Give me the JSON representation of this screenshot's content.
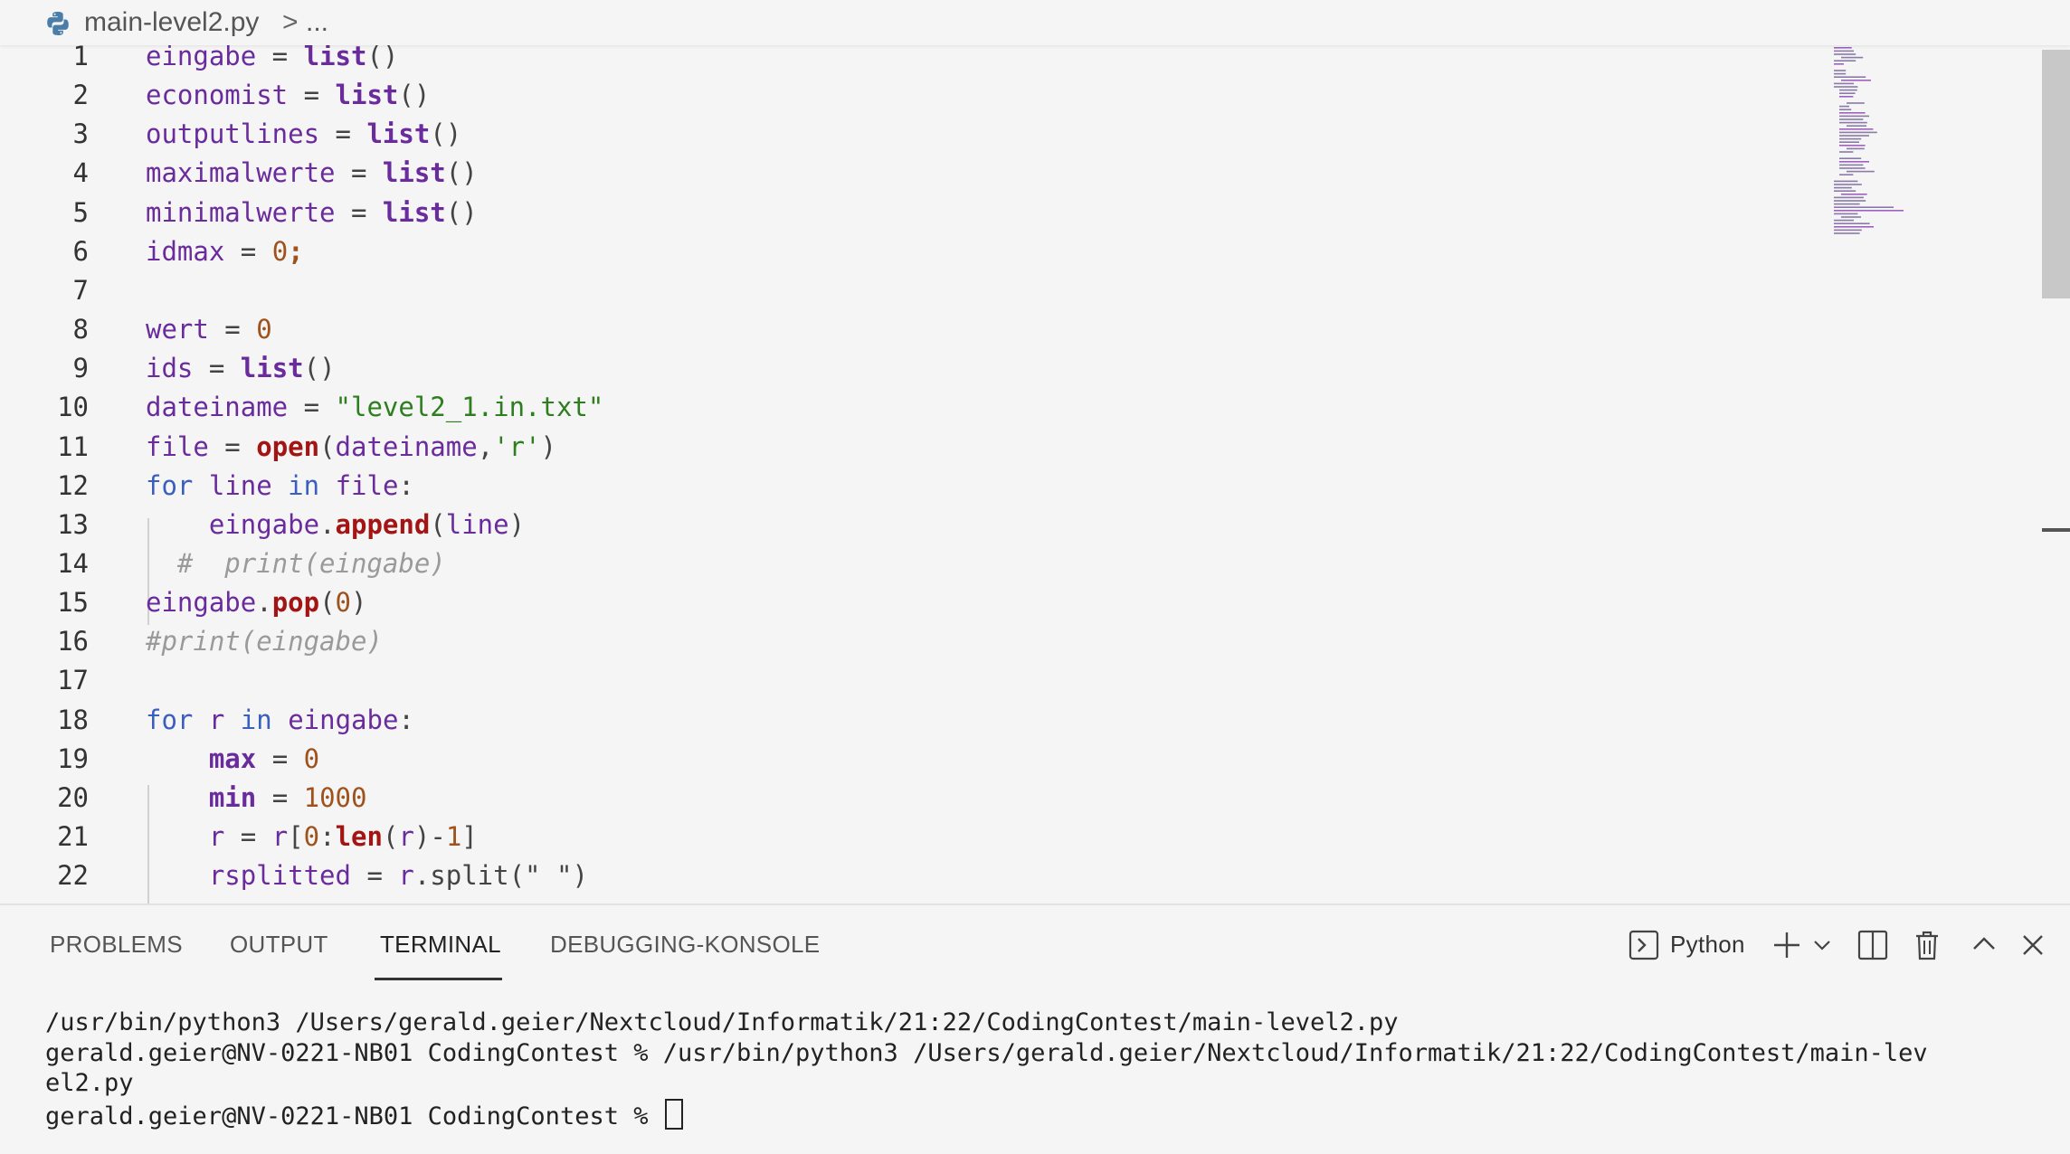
{
  "breadcrumb": {
    "file": "main-level2.py",
    "separator": ">",
    "more": "...",
    "file_icon": "python-icon"
  },
  "editor": {
    "lines": [
      {
        "n": "1",
        "tokens": [
          [
            "var",
            "eingabe"
          ],
          [
            "op",
            " = "
          ],
          [
            "fn",
            "list"
          ],
          [
            "op",
            "()"
          ]
        ]
      },
      {
        "n": "2",
        "tokens": [
          [
            "var",
            "economist"
          ],
          [
            "op",
            " = "
          ],
          [
            "fn",
            "list"
          ],
          [
            "op",
            "()"
          ]
        ]
      },
      {
        "n": "3",
        "tokens": [
          [
            "var",
            "outputlines"
          ],
          [
            "op",
            " = "
          ],
          [
            "fn",
            "list"
          ],
          [
            "op",
            "()"
          ]
        ]
      },
      {
        "n": "4",
        "tokens": [
          [
            "var",
            "maximalwerte"
          ],
          [
            "op",
            " = "
          ],
          [
            "fn",
            "list"
          ],
          [
            "op",
            "()"
          ]
        ]
      },
      {
        "n": "5",
        "tokens": [
          [
            "var",
            "minimalwerte"
          ],
          [
            "op",
            " = "
          ],
          [
            "fn",
            "list"
          ],
          [
            "op",
            "()"
          ]
        ]
      },
      {
        "n": "6",
        "tokens": [
          [
            "var",
            "idmax"
          ],
          [
            "op",
            " = "
          ],
          [
            "num",
            "0"
          ],
          [
            "semi",
            ";"
          ]
        ]
      },
      {
        "n": "7",
        "tokens": []
      },
      {
        "n": "8",
        "tokens": [
          [
            "var",
            "wert"
          ],
          [
            "op",
            " = "
          ],
          [
            "num",
            "0"
          ]
        ]
      },
      {
        "n": "9",
        "tokens": [
          [
            "var",
            "ids"
          ],
          [
            "op",
            " = "
          ],
          [
            "fn",
            "list"
          ],
          [
            "op",
            "()"
          ]
        ]
      },
      {
        "n": "10",
        "tokens": [
          [
            "var",
            "dateiname"
          ],
          [
            "op",
            " = "
          ],
          [
            "str",
            "\"level2_1.in.txt\""
          ]
        ]
      },
      {
        "n": "11",
        "tokens": [
          [
            "var",
            "file"
          ],
          [
            "op",
            " = "
          ],
          [
            "bi",
            "open"
          ],
          [
            "op",
            "("
          ],
          [
            "var",
            "dateiname"
          ],
          [
            "op",
            ","
          ],
          [
            "str",
            "'r'"
          ],
          [
            "op",
            ")"
          ]
        ]
      },
      {
        "n": "12",
        "tokens": [
          [
            "kw",
            "for"
          ],
          [
            "op",
            " "
          ],
          [
            "var",
            "line"
          ],
          [
            "op",
            " "
          ],
          [
            "kw",
            "in"
          ],
          [
            "op",
            " "
          ],
          [
            "var",
            "file"
          ],
          [
            "op",
            ":"
          ]
        ]
      },
      {
        "n": "13",
        "tokens": [
          [
            "op",
            "    "
          ],
          [
            "var",
            "eingabe"
          ],
          [
            "op",
            "."
          ],
          [
            "bi",
            "append"
          ],
          [
            "op",
            "("
          ],
          [
            "var",
            "line"
          ],
          [
            "op",
            ")"
          ]
        ]
      },
      {
        "n": "14",
        "tokens": [
          [
            "op",
            "  "
          ],
          [
            "cmt",
            "#  print(eingabe)"
          ]
        ]
      },
      {
        "n": "15",
        "tokens": [
          [
            "var",
            "eingabe"
          ],
          [
            "op",
            "."
          ],
          [
            "bi",
            "pop"
          ],
          [
            "op",
            "("
          ],
          [
            "num",
            "0"
          ],
          [
            "op",
            ")"
          ]
        ]
      },
      {
        "n": "16",
        "tokens": [
          [
            "cmt",
            "#print(eingabe)"
          ]
        ]
      },
      {
        "n": "17",
        "tokens": []
      },
      {
        "n": "18",
        "tokens": [
          [
            "kw",
            "for"
          ],
          [
            "op",
            " "
          ],
          [
            "var",
            "r"
          ],
          [
            "op",
            " "
          ],
          [
            "kw",
            "in"
          ],
          [
            "op",
            " "
          ],
          [
            "var",
            "eingabe"
          ],
          [
            "op",
            ":"
          ]
        ]
      },
      {
        "n": "19",
        "tokens": [
          [
            "op",
            "    "
          ],
          [
            "fn",
            "max"
          ],
          [
            "op",
            " = "
          ],
          [
            "num",
            "0"
          ]
        ]
      },
      {
        "n": "20",
        "tokens": [
          [
            "op",
            "    "
          ],
          [
            "fn",
            "min"
          ],
          [
            "op",
            " = "
          ],
          [
            "num",
            "1000"
          ]
        ]
      },
      {
        "n": "21",
        "tokens": [
          [
            "op",
            "    "
          ],
          [
            "var",
            "r"
          ],
          [
            "op",
            " = "
          ],
          [
            "var",
            "r"
          ],
          [
            "op",
            "["
          ],
          [
            "num",
            "0"
          ],
          [
            "op",
            ":"
          ],
          [
            "bi",
            "len"
          ],
          [
            "op",
            "("
          ],
          [
            "var",
            "r"
          ],
          [
            "op",
            ")-"
          ],
          [
            "num",
            "1"
          ],
          [
            "op",
            "]"
          ]
        ]
      },
      {
        "n": "22",
        "tokens": [
          [
            "op",
            "    "
          ],
          [
            "var",
            "rsplitted"
          ],
          [
            "op",
            " = "
          ],
          [
            "var",
            "r"
          ],
          [
            "op",
            ".split(\" \")"
          ]
        ]
      }
    ]
  },
  "panel": {
    "tabs": [
      "PROBLEMS",
      "OUTPUT",
      "TERMINAL",
      "DEBUGGING-KONSOLE"
    ],
    "active_tab": "TERMINAL",
    "terminal_profile": "Python",
    "terminal_lines": [
      "/usr/bin/python3 /Users/gerald.geier/Nextcloud/Informatik/21:22/CodingContest/main-level2.py",
      "gerald.geier@NV-0221-NB01 CodingContest % /usr/bin/python3 /Users/gerald.geier/Nextcloud/Informatik/21:22/CodingContest/main-lev",
      "el2.py",
      "gerald.geier@NV-0221-NB01 CodingContest % "
    ]
  },
  "colors": {
    "background": "#f5f5f5",
    "variable": "#6a2b9c",
    "builtin": "#a31515",
    "keyword": "#3a5fbf",
    "number": "#a0521c",
    "string": "#2e7d1e",
    "comment": "#9a9a9a"
  }
}
